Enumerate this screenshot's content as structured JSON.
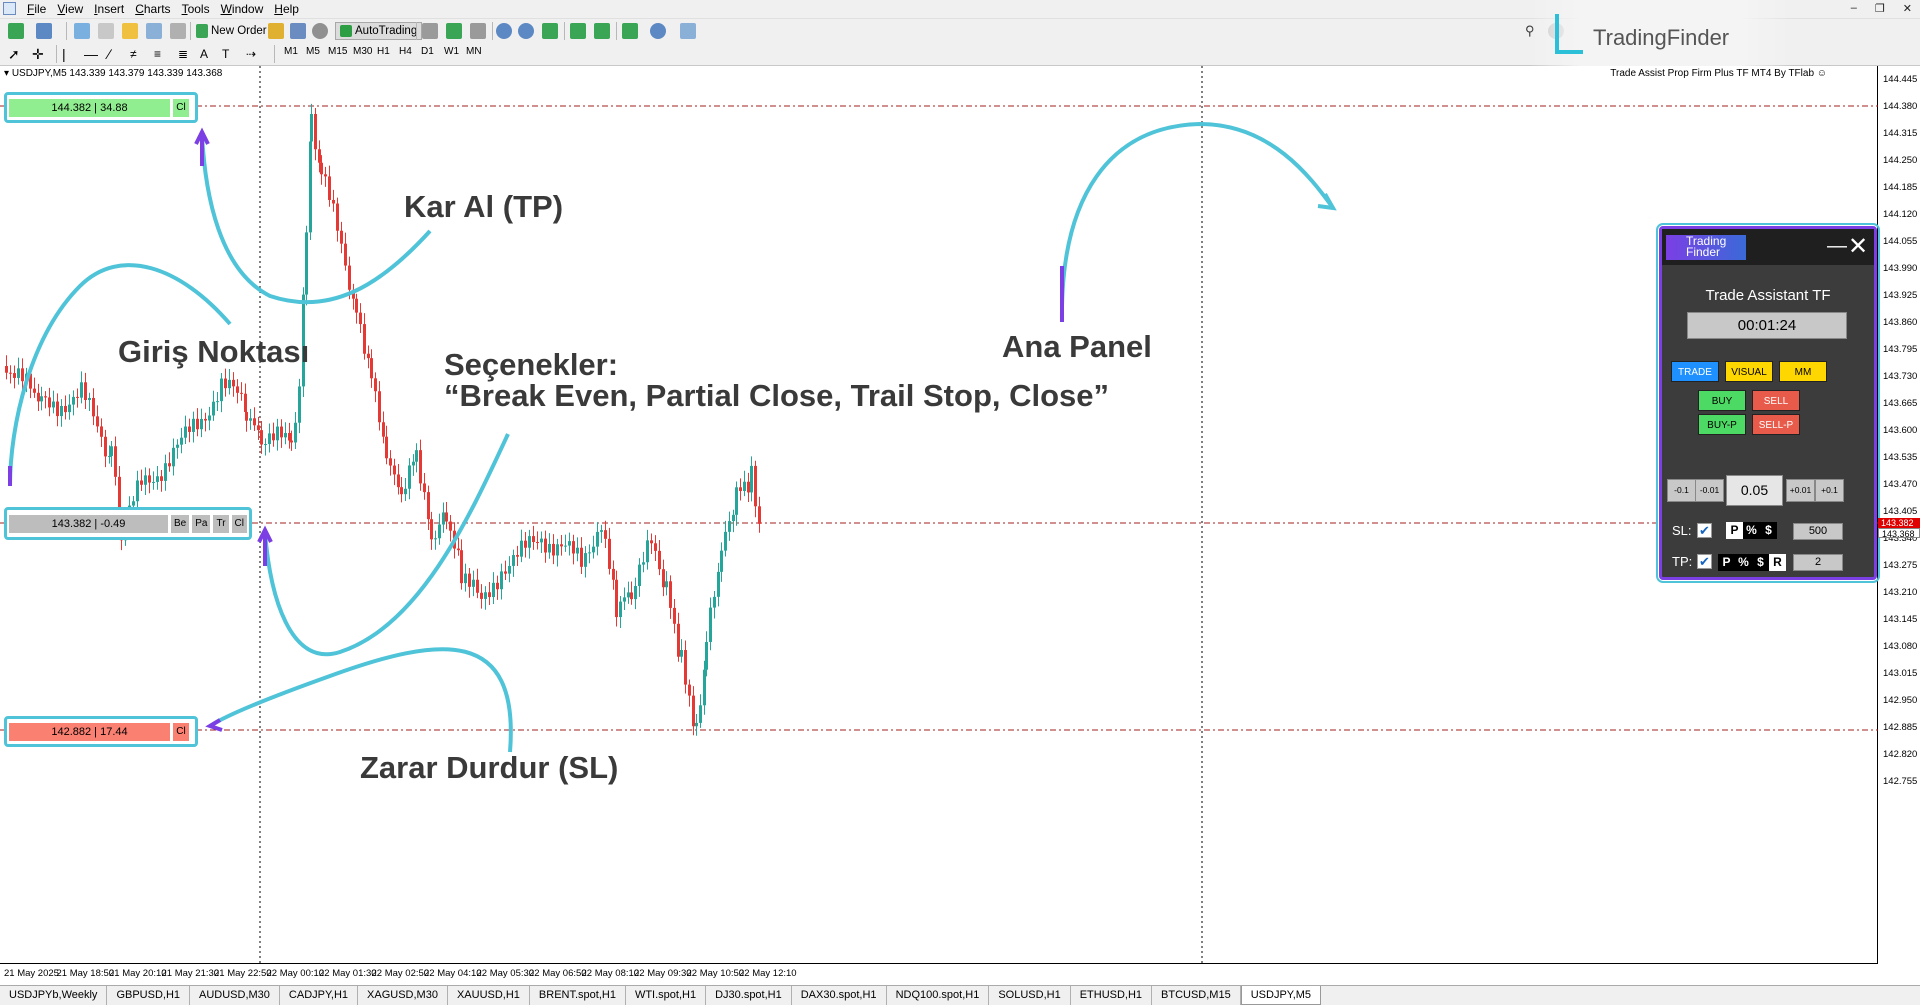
{
  "menu": [
    "File",
    "View",
    "Insert",
    "Charts",
    "Tools",
    "Window",
    "Help"
  ],
  "toolbar": {
    "new_order": "New Order",
    "autotrading": "AutoTrading"
  },
  "timeframes": [
    "M1",
    "M5",
    "M15",
    "M30",
    "H1",
    "H4",
    "D1",
    "W1",
    "MN"
  ],
  "watermark": "TradingFinder",
  "chart": {
    "symbol_info": "USDJPY,M5  143.339 143.379 143.339 143.368",
    "ea_name": "Trade Assist Prop Firm Plus TF MT4 By TFlab",
    "price_labels": [
      "144.445",
      "144.380",
      "144.315",
      "144.250",
      "144.185",
      "144.120",
      "144.055",
      "143.990",
      "143.925",
      "143.860",
      "143.795",
      "143.730",
      "143.665",
      "143.600",
      "143.535",
      "143.470",
      "143.405",
      "143.340",
      "143.275",
      "143.210",
      "143.145",
      "143.080",
      "143.015",
      "142.950",
      "142.885",
      "142.820",
      "142.755"
    ],
    "current_price": "143.382",
    "current_price2": "143.368",
    "time_labels": [
      "21 May 2025",
      "21 May 18:50",
      "21 May 20:10",
      "21 May 21:30",
      "21 May 22:50",
      "22 May 00:10",
      "22 May 01:30",
      "22 May 02:50",
      "22 May 04:10",
      "22 May 05:30",
      "22 May 06:50",
      "22 May 08:10",
      "22 May 09:30",
      "22 May 10:50",
      "22 May 12:10"
    ]
  },
  "lines": {
    "tp": {
      "value": "144.382 | 34.88",
      "buttons": [
        "Cl"
      ]
    },
    "entry": {
      "value": "143.382 | -0.49",
      "buttons": [
        "Be",
        "Pa",
        "Tr",
        "Cl"
      ]
    },
    "sl": {
      "value": "142.882 | 17.44",
      "buttons": [
        "Cl"
      ]
    }
  },
  "annotations": {
    "tp": "Kar Al (TP)",
    "entry": "Giriş Noktası",
    "options_line1": "Seçenekler:",
    "options_line2": "“Break Even, Partial Close, Trail Stop, Close”",
    "panel": "Ana Panel",
    "sl": "Zarar Durdur (SL)"
  },
  "panel": {
    "logo": "Trading Finder",
    "title": "Trade Assistant TF",
    "timer": "00:01:24",
    "tabs": [
      "TRADE",
      "VISUAL",
      "MM"
    ],
    "buy": "BUY",
    "sell": "SELL",
    "buy_p": "BUY-P",
    "sell_p": "SELL-P",
    "steps_minus": [
      "-0.1",
      "-0.01"
    ],
    "steps_plus": [
      "+0.01",
      "+0.1"
    ],
    "lot": "0.05",
    "sl_label": "SL:",
    "tp_label": "TP:",
    "sl_modes": [
      "P",
      "%",
      "$"
    ],
    "tp_modes": [
      "P",
      "%",
      "$",
      "R"
    ],
    "sl_value": "500",
    "tp_value": "2"
  },
  "tabs": [
    "USDJPYb,Weekly",
    "GBPUSD,H1",
    "AUDUSD,M30",
    "CADJPY,H1",
    "XAGUSD,M30",
    "XAUUSD,H1",
    "BRENT.spot,H1",
    "WTI.spot,H1",
    "DJ30.spot,H1",
    "DAX30.spot,H1",
    "NDQ100.spot,H1",
    "SOLUSD,H1",
    "ETHUSD,H1",
    "BTCUSD,M15",
    "USDJPY,M5"
  ],
  "colors": {
    "tp_fill": "#90ee90",
    "sl_fill": "#fa8072",
    "entry_fill": "#bdbdbd",
    "annot_cyan": "#4fc3d8",
    "annot_purple": "#7b3fe4",
    "buy": "#4cd964",
    "sell": "#e85a4a"
  }
}
